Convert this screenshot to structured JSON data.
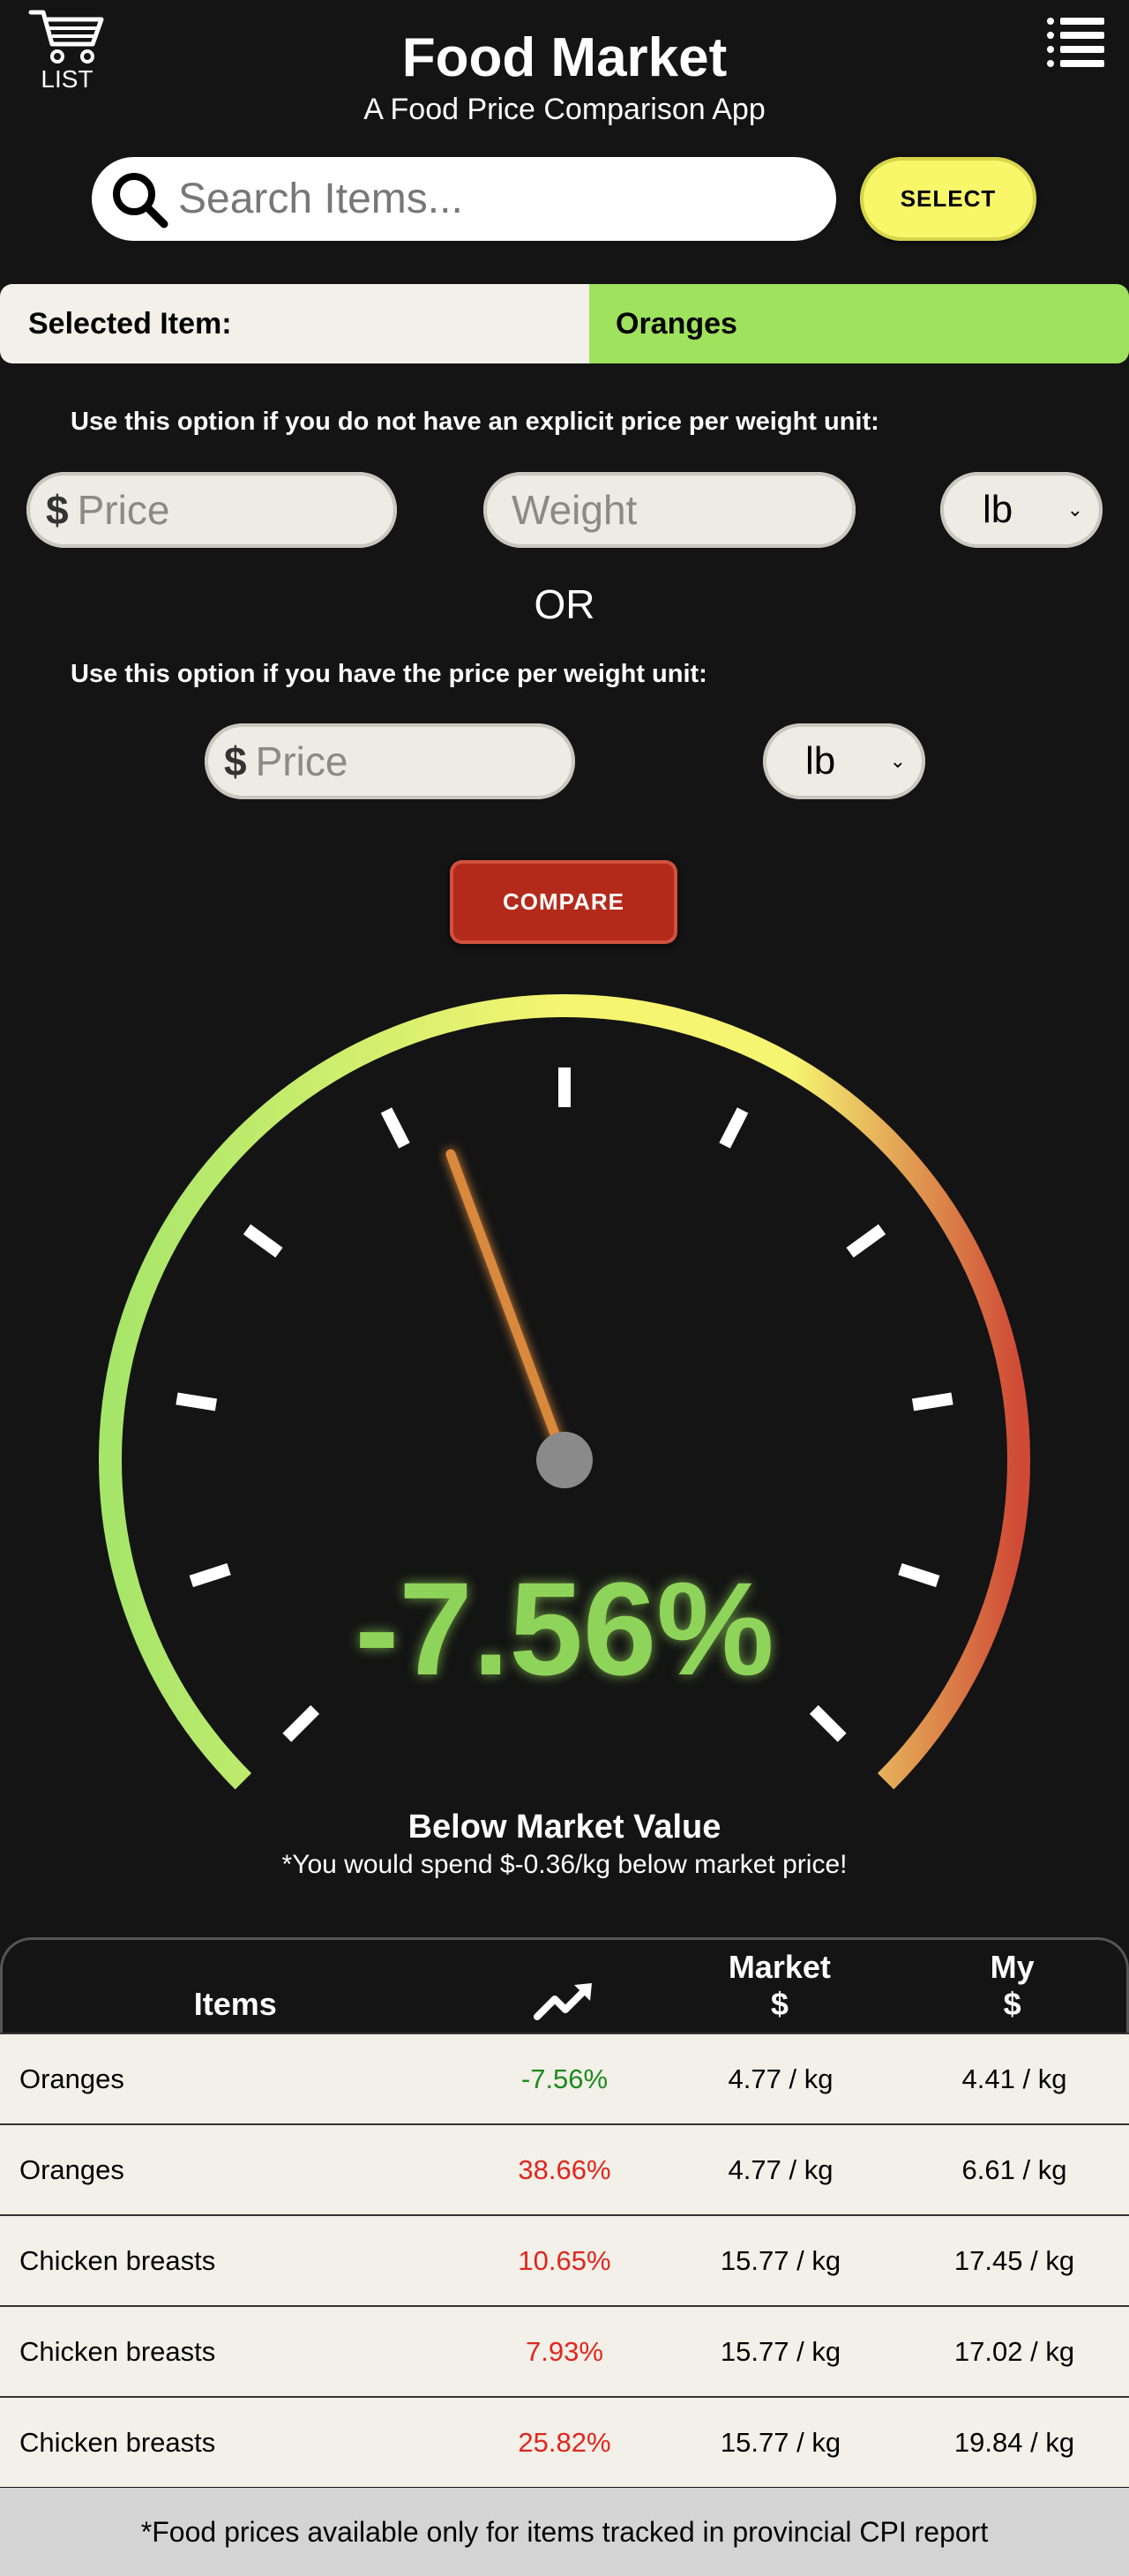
{
  "header": {
    "cart_label": "LIST",
    "title": "Food Market",
    "subtitle": "A Food Price Comparison App"
  },
  "search": {
    "placeholder": "Search Items...",
    "select_label": "SELECT"
  },
  "selected": {
    "label": "Selected Item:",
    "value": "Oranges"
  },
  "option1": {
    "hint": "Use this option if you do not have an explicit price per weight unit:",
    "price_placeholder": "Price",
    "weight_placeholder": "Weight",
    "unit": "lb"
  },
  "or_label": "OR",
  "option2": {
    "hint": "Use this option if you have the price per weight unit:",
    "price_placeholder": "Price",
    "unit": "lb"
  },
  "compare_label": "COMPARE",
  "gauge": {
    "percent_text": "-7.56%",
    "needle_value": -7.56,
    "scale_min": -50,
    "scale_max": 50,
    "status": "Below Market Value",
    "note": "*You would spend $-0.36/kg below market price!",
    "colors": {
      "low": "#a6e66a",
      "mid": "#f5f571",
      "high": "#cf4a36"
    }
  },
  "table": {
    "headers": {
      "items": "Items",
      "trend_icon": "trend-up-icon",
      "market_line1": "Market",
      "market_line2": "$",
      "my_line1": "My",
      "my_line2": "$"
    },
    "rows": [
      {
        "item": "Oranges",
        "change": "-7.56%",
        "market": "4.77 / kg",
        "my": "4.41 / kg"
      },
      {
        "item": "Oranges",
        "change": "38.66%",
        "market": "4.77 / kg",
        "my": "6.61 / kg"
      },
      {
        "item": "Chicken breasts",
        "change": "10.65%",
        "market": "15.77 / kg",
        "my": "17.45 / kg"
      },
      {
        "item": "Chicken breasts",
        "change": "7.93%",
        "market": "15.77 / kg",
        "my": "17.02 / kg"
      },
      {
        "item": "Chicken breasts",
        "change": "25.82%",
        "market": "15.77 / kg",
        "my": "19.84 / kg"
      }
    ]
  },
  "footer": "*Food prices available only for items tracked in provincial CPI report"
}
